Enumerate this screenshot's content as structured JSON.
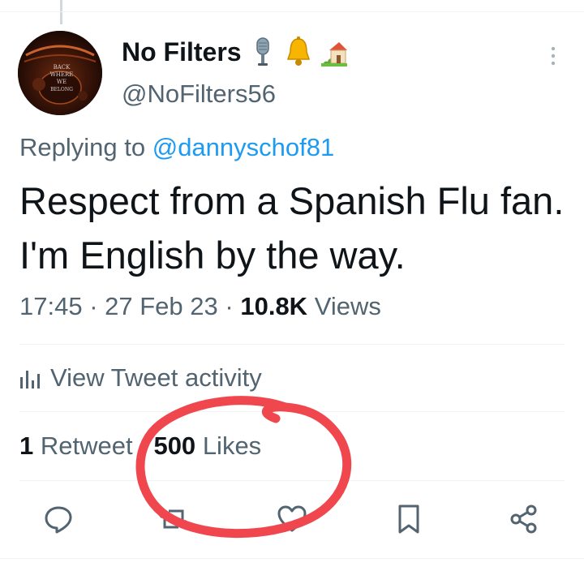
{
  "tweet": {
    "display_name": "No Filters",
    "name_emojis": [
      "microphone-emoji",
      "bell-emoji",
      "house-with-garden-emoji"
    ],
    "handle": "@NoFilters56",
    "avatar_text": "BACK WHERE WE BELONG",
    "replying_prefix": "Replying to",
    "replying_mention": "@dannyschof81",
    "text": "Respect from a Spanish Flu fan. I'm English by the way.",
    "time": "17:45",
    "separator": "·",
    "date": "27 Feb 23",
    "views_count": "10.8K",
    "views_label": "Views"
  },
  "activity": {
    "label": "View Tweet activity",
    "icon": "analytics-bars-icon"
  },
  "stats": {
    "retweets_count": "1",
    "retweets_label": "Retweet",
    "likes_count": "500",
    "likes_label": "Likes"
  },
  "actions": [
    "reply-icon",
    "retweet-icon",
    "like-icon",
    "bookmark-icon",
    "share-icon"
  ],
  "colors": {
    "text_primary": "#0f1419",
    "text_secondary": "#536471",
    "link": "#1d9bf0",
    "divider": "#eff3f4",
    "annotation_red": "#f0474f"
  }
}
